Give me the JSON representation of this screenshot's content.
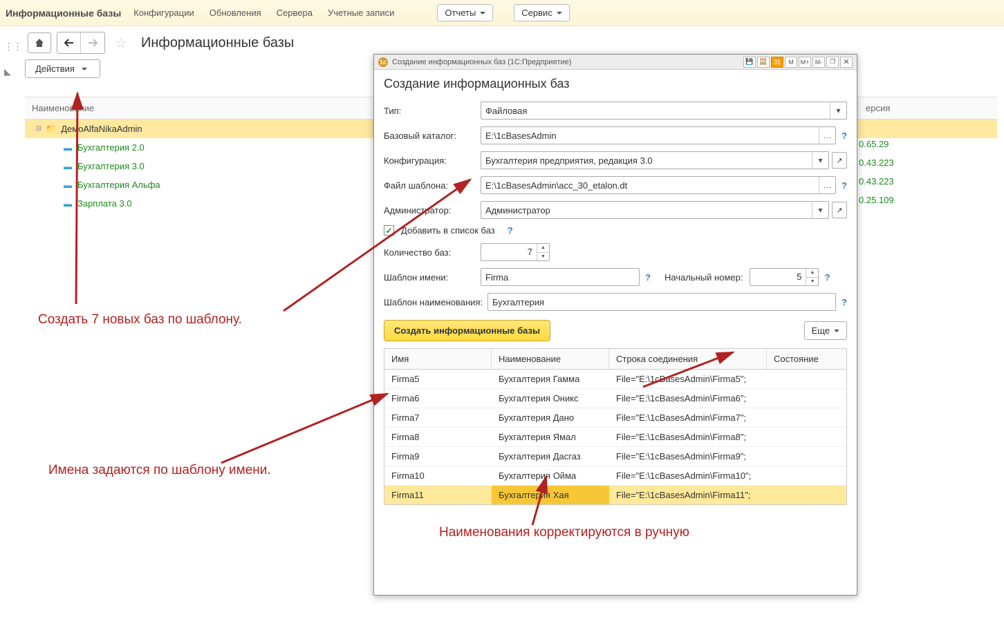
{
  "topbar": {
    "app_title": "Информационные базы",
    "menu_config": "Конфигурации",
    "menu_updates": "Обновления",
    "menu_servers": "Сервера",
    "menu_accounts": "Учетные записи",
    "reports_btn": "Отчеты",
    "service_btn": "Сервис"
  },
  "page": {
    "heading": "Информационные базы",
    "actions_btn": "Действия"
  },
  "tree": {
    "header_name": "Наименование",
    "header_version": "ерсия",
    "root": "ДемоAlfaNikaAdmin",
    "items": [
      {
        "label": "Бухгалтерия 2.0",
        "version": "0.65.29"
      },
      {
        "label": "Бухгалтерия 3.0",
        "version": "0.43.223"
      },
      {
        "label": "Бухгалтерия Альфа",
        "version": "0.43.223"
      },
      {
        "label": "Зарплата 3.0",
        "version": "0.25.109"
      }
    ]
  },
  "dialog": {
    "titlebar": "Создание информационных баз  (1С:Предприятие)",
    "tb_M": "M",
    "tb_Mplus": "M+",
    "tb_Mminus": "M-",
    "heading": "Создание информационных баз",
    "type_label": "Тип:",
    "type_value": "Файловая",
    "basedir_label": "Базовый каталог:",
    "basedir_value": "E:\\1cBasesAdmin",
    "config_label": "Конфигурация:",
    "config_value": "Бухгалтерия предприятия, редакция 3.0",
    "template_file_label": "Файл шаблона:",
    "template_file_value": "E:\\1cBasesAdmin\\acc_30_etalon.dt",
    "admin_label": "Администратор:",
    "admin_value": "Администратор",
    "add_to_list_label": "Добавить в список баз",
    "count_label": "Количество баз:",
    "count_value": "7",
    "name_template_label": "Шаблон имени:",
    "name_template_value": "Firma",
    "start_num_label": "Начальный номер:",
    "start_num_value": "5",
    "title_template_label": "Шаблон наименования:",
    "title_template_value": "Бухгалтерия",
    "create_btn": "Создать информационные базы",
    "more_btn": "Еще",
    "table": {
      "col_name": "Имя",
      "col_title": "Наименование",
      "col_conn": "Строка соединения",
      "col_state": "Состояние",
      "rows": [
        {
          "name": "Firma5",
          "title": "Бухгалтерия Гамма",
          "conn": "File=\"E:\\1cBasesAdmin\\Firma5\";"
        },
        {
          "name": "Firma6",
          "title": "Бухгалтерия Оникс",
          "conn": "File=\"E:\\1cBasesAdmin\\Firma6\";"
        },
        {
          "name": "Firma7",
          "title": "Бухгалтерия Дано",
          "conn": "File=\"E:\\1cBasesAdmin\\Firma7\";"
        },
        {
          "name": "Firma8",
          "title": "Бухгалтерия Ямал",
          "conn": "File=\"E:\\1cBasesAdmin\\Firma8\";"
        },
        {
          "name": "Firma9",
          "title": "Бухгалтерия Дасгаз",
          "conn": "File=\"E:\\1cBasesAdmin\\Firma9\";"
        },
        {
          "name": "Firma10",
          "title": "Бухгалтерия Ойма",
          "conn": "File=\"E:\\1cBasesAdmin\\Firma10\";"
        },
        {
          "name": "Firma11",
          "title": "Бухгалтерия Хая",
          "conn": "File=\"E:\\1cBasesAdmin\\Firma11\";"
        }
      ]
    }
  },
  "annotations": {
    "a1": "Создать 7 новых баз по шаблону.",
    "a2": "Имена задаются по шаблону имени.",
    "a3": "Наименования корректируются в ручную"
  }
}
